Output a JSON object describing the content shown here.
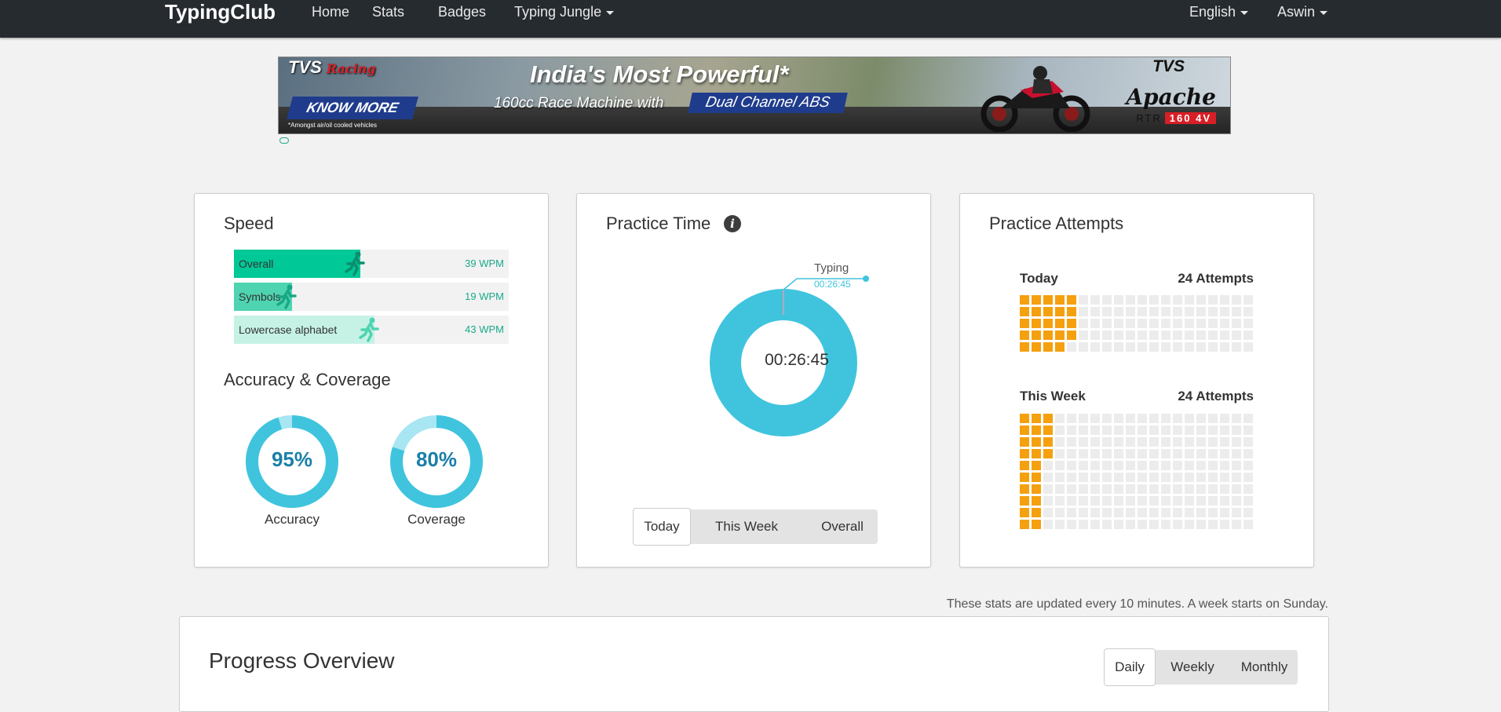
{
  "nav": {
    "brand": "TypingClub",
    "items": [
      "Home",
      "Stats",
      "Badges",
      "Typing Jungle"
    ],
    "language": "English",
    "user": "Aswin"
  },
  "ad": {
    "brand": "TVS",
    "brand_sub": "Racing",
    "headline": "India's Most Powerful*",
    "sub": "160cc Race Machine with",
    "pill": "Dual Channel ABS",
    "cta": "KNOW MORE",
    "note": "*Amongst air/oil cooled vehicles",
    "logo_right": "TVS",
    "model": "Apache",
    "model_rtr": "RTR",
    "model_num": "160 4V"
  },
  "speed": {
    "title": "Speed",
    "rows": [
      {
        "label": "Overall",
        "value": "39 WPM",
        "fill": 0.46,
        "color": "#00c896"
      },
      {
        "label": "Symbols",
        "value": "19 WPM",
        "fill": 0.21,
        "color": "#4ed4b0"
      },
      {
        "label": "Lowercase alphabet",
        "value": "43 WPM",
        "fill": 0.51,
        "color": "#c6f2e6"
      }
    ]
  },
  "accuracy": {
    "title": "Accuracy & Coverage",
    "rings": [
      {
        "pct_text": "95%",
        "label": "Accuracy",
        "fraction": 0.95
      },
      {
        "pct_text": "80%",
        "label": "Coverage",
        "fraction": 0.8
      }
    ]
  },
  "practice_time": {
    "title": "Practice Time",
    "center": "00:26:45",
    "callout_label": "Typing",
    "callout_time": "00:26:45",
    "tabs": [
      "Today",
      "This Week",
      "Overall"
    ],
    "active_tab": "Today",
    "color": "#40c4de"
  },
  "attempts": {
    "title": "Practice Attempts",
    "today_label": "Today",
    "today_count": "24 Attempts",
    "today_value": 24,
    "week_label": "This Week",
    "week_count": "24 Attempts",
    "week_value": 24,
    "filled_color": "#f5a00f",
    "empty_color": "#ececec"
  },
  "footnote": "These stats are updated every 10 minutes. A week starts on Sunday.",
  "progress": {
    "title": "Progress Overview",
    "tabs": [
      "Daily",
      "Weekly",
      "Monthly"
    ],
    "active_tab": "Daily"
  }
}
